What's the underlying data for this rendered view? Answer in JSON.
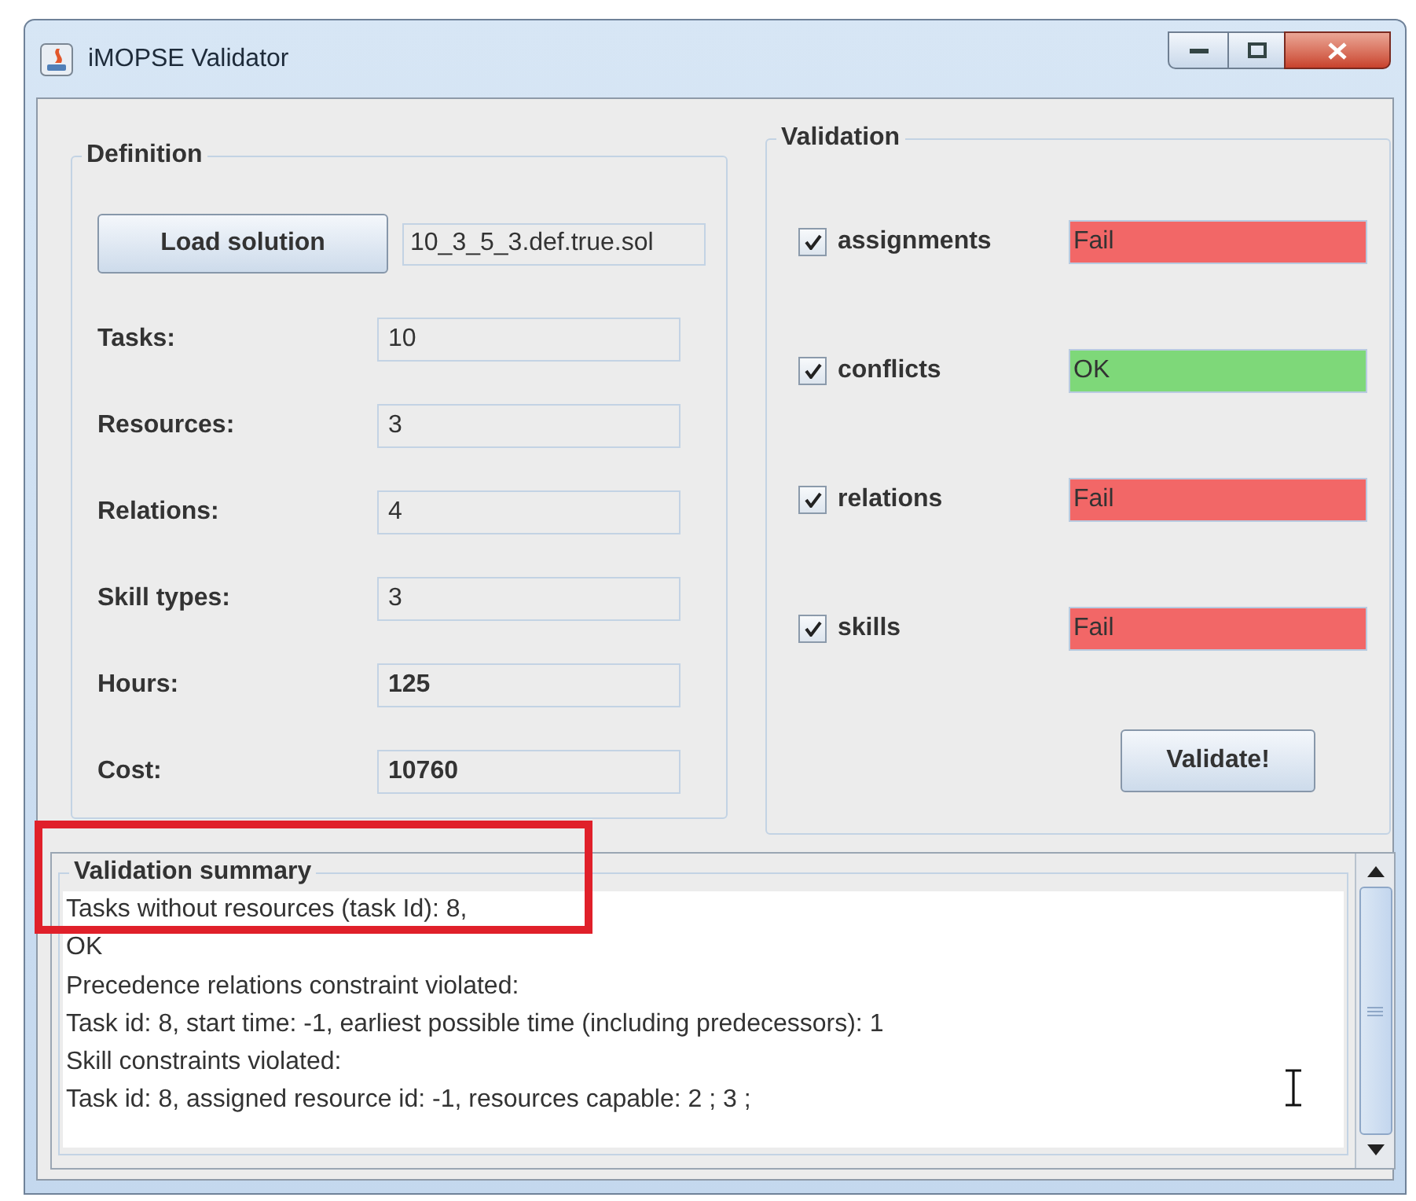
{
  "window": {
    "title": "iMOPSE Validator"
  },
  "definition": {
    "title": "Definition",
    "load_button": "Load solution",
    "file": "10_3_5_3.def.true.sol",
    "fields": [
      {
        "label": "Tasks:",
        "value": "10",
        "bold": false
      },
      {
        "label": "Resources:",
        "value": "3",
        "bold": false
      },
      {
        "label": "Relations:",
        "value": "4",
        "bold": false
      },
      {
        "label": "Skill types:",
        "value": "3",
        "bold": false
      },
      {
        "label": "Hours:",
        "value": "125",
        "bold": true
      },
      {
        "label": "Cost:",
        "value": "10760",
        "bold": true
      }
    ]
  },
  "validation": {
    "title": "Validation",
    "button": "Validate!",
    "checks": [
      {
        "label": "assignments",
        "checked": true,
        "result": "Fail",
        "color": "#f26767"
      },
      {
        "label": "conflicts",
        "checked": true,
        "result": "OK",
        "color": "#7ed879"
      },
      {
        "label": "relations",
        "checked": true,
        "result": "Fail",
        "color": "#f26767"
      },
      {
        "label": "skills",
        "checked": true,
        "result": "Fail",
        "color": "#f26767"
      }
    ]
  },
  "summary": {
    "title": "Validation summary",
    "lines": [
      "Tasks without resources (task Id): 8,",
      "OK",
      "Precedence relations constraint violated:",
      "Task id: 8, start time: -1, earliest possible time (including predecessors): 1",
      "Skill constraints violated:",
      "Task id: 8, assigned resource id: -1, resources capable: 2 ; 3 ;"
    ]
  }
}
